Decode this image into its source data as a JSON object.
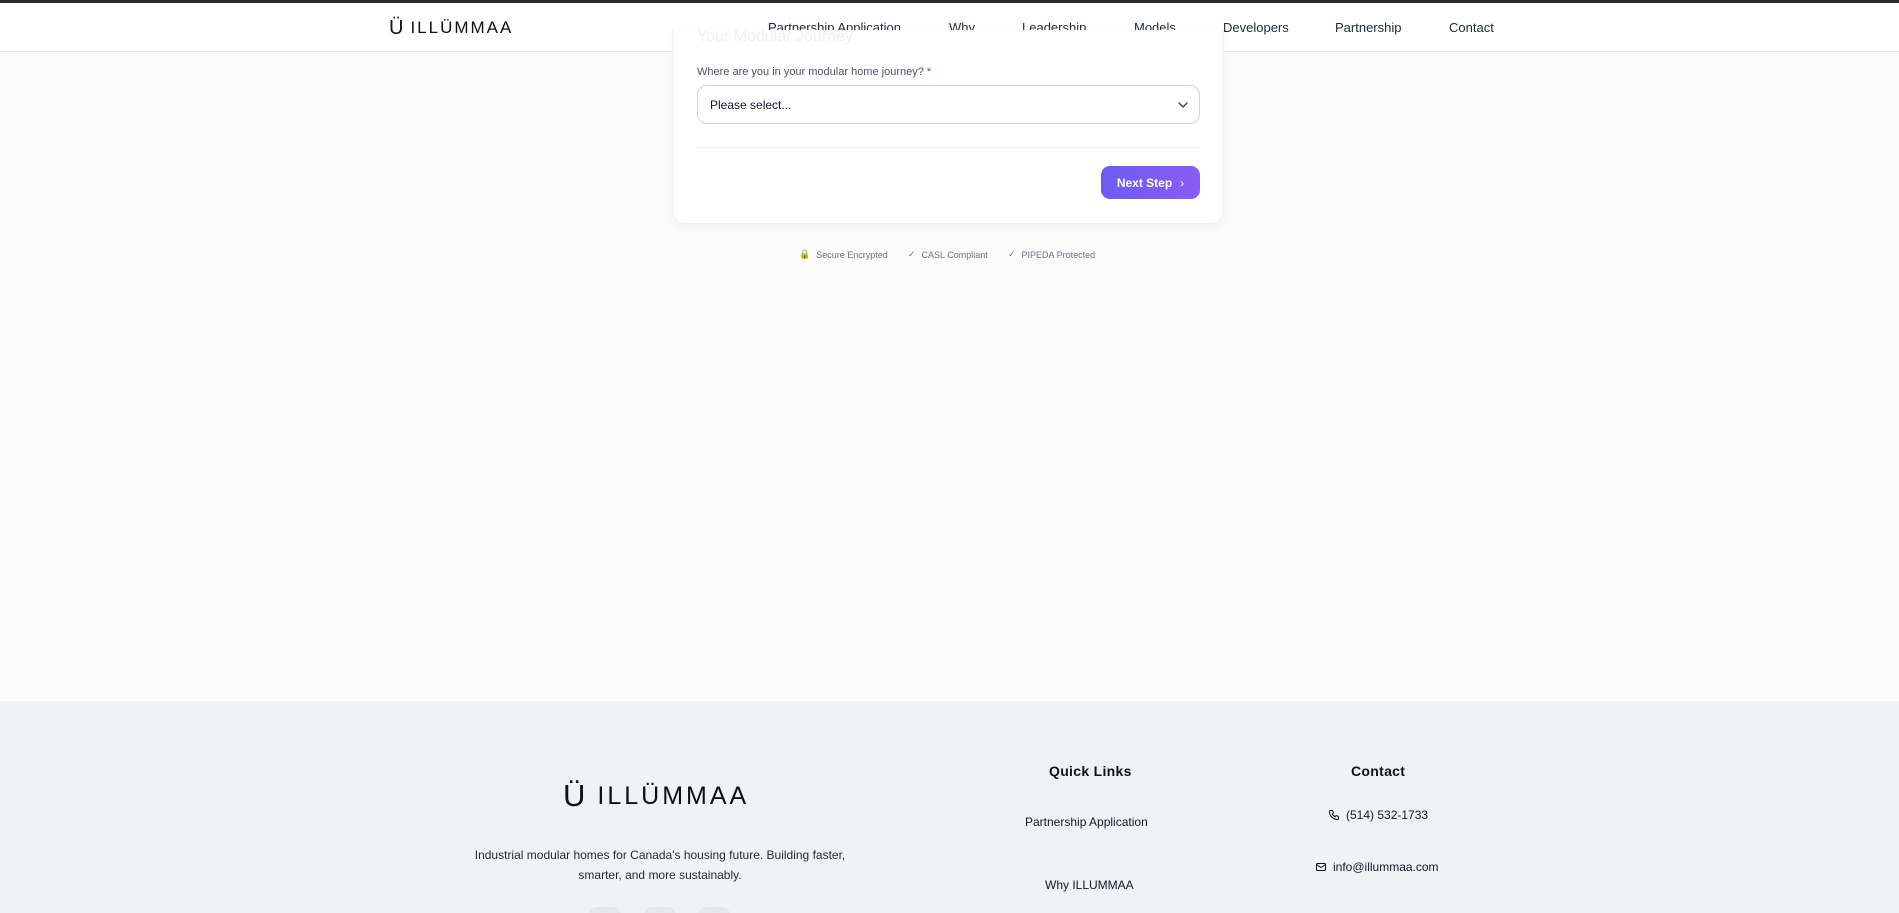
{
  "brand": {
    "logo_mark": "Ü",
    "logo_word": "ILLÜMMAA"
  },
  "nav": {
    "items": [
      {
        "label": "Partnership Application"
      },
      {
        "label": "Why"
      },
      {
        "label": "Leadership"
      },
      {
        "label": "Models"
      },
      {
        "label": "Developers"
      },
      {
        "label": "Partnership"
      },
      {
        "label": "Contact"
      }
    ]
  },
  "form": {
    "faded_title": "Your Modular Journey",
    "question": "Where are you in your modular home journey?",
    "required_mark": "*",
    "select_value": "Please select...",
    "next_label": "Next Step",
    "next_icon": "chevron-right-icon",
    "accent_color": "#7c5cf3"
  },
  "trust": [
    {
      "icon": "lock-icon",
      "symbol": "🔒",
      "label": "Secure Encrypted"
    },
    {
      "icon": "check-icon",
      "symbol": "✓",
      "label": "CASL Compliant"
    },
    {
      "icon": "check-icon",
      "symbol": "✓",
      "label": "PIPEDA Protected"
    }
  ],
  "footer": {
    "logo_mark": "Ü",
    "logo_word": "ILLÜMMAA",
    "description": "Industrial modular homes for Canada's housing future. Building faster, smarter, and more sustainably.",
    "quick_links_title": "Quick Links",
    "quick_links": [
      {
        "label": "Partnership Application"
      },
      {
        "label": "Why ILLUMMAA"
      }
    ],
    "contact_title": "Contact",
    "phone": "(514) 532-1733",
    "email": "info@illummaa.com"
  }
}
